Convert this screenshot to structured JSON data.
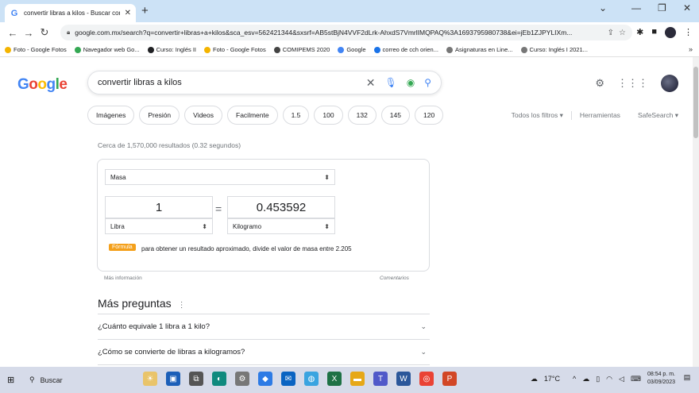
{
  "browser": {
    "tab_title": "convertir libras a kilos - Buscar con Google",
    "favicon": "G",
    "url": "google.com.mx/search?q=convertir+libras+a+kilos&sca_esv=562421344&sxsrf=AB5stBjN4VVF2dLrk-AhxdS7VmrlIMQPAQ%3A1693795980738&ei=jEb1ZJPYLIXm...",
    "bookmarks": [
      {
        "label": "Foto - Google Fotos",
        "color": "#f4b400"
      },
      {
        "label": "Navegador web Go...",
        "color": "#34a853"
      },
      {
        "label": "Curso: Inglés II",
        "color": "#202124"
      },
      {
        "label": "Foto - Google Fotos",
        "color": "#f4b400"
      },
      {
        "label": "COMIPEMS 2020",
        "color": "#444444"
      },
      {
        "label": "Google",
        "color": "#4285f4"
      },
      {
        "label": "correo de cch orien...",
        "color": "#1a73e8"
      },
      {
        "label": "Asignaturas en Line...",
        "color": "#777777"
      },
      {
        "label": "Curso: Inglés I 2021...",
        "color": "#777777"
      }
    ],
    "bookmarks_more": "»",
    "new_tab": "+",
    "tab_close": "✕"
  },
  "search": {
    "logo": [
      "G",
      "o",
      "o",
      "g",
      "l",
      "e"
    ],
    "logo_colors": [
      "#4285f4",
      "#ea4335",
      "#fbbc05",
      "#4285f4",
      "#34a853",
      "#ea4335"
    ],
    "query": "convertir libras a kilos",
    "chips": [
      "Imágenes",
      "Presión",
      "Videos",
      "Facilmente",
      "1.5",
      "100",
      "132",
      "145",
      "120"
    ],
    "all_filters": "Todos los filtros",
    "tools": "Herramientas",
    "safesearch": "SafeSearch",
    "stats": "Cerca de 1,570,000 resultados (0.32 segundos)"
  },
  "converter": {
    "quantity": "Masa",
    "from_value": "1",
    "to_value": "0.453592",
    "from_unit": "Libra",
    "to_unit": "Kilogramo",
    "equals": "=",
    "formula_badge": "Fórmula",
    "formula_text": "para obtener un resultado aproximado, divide el valor de masa entre 2.205",
    "more_info": "Más información",
    "feedback": "Comentarios"
  },
  "paa": {
    "title": "Más preguntas",
    "questions": [
      "¿Cuánto equivale 1 libra a 1 kilo?",
      "¿Cómo se convierte de libras a kilogramos?"
    ]
  },
  "taskbar": {
    "search_label": "Buscar",
    "weather": "17°C",
    "time": "08:54 p. m.",
    "date": "03/09/2023"
  }
}
